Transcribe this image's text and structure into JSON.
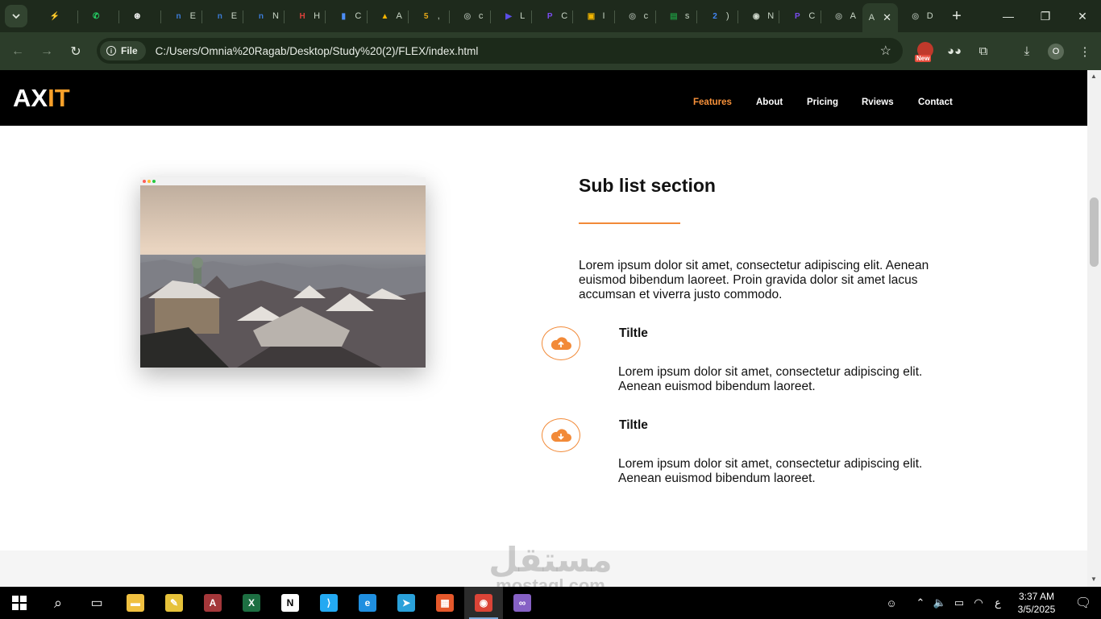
{
  "browser": {
    "tabs": [
      {
        "icon": "sparkle-icon",
        "color": "#f5a623",
        "glyph": "⚡",
        "label": ""
      },
      {
        "icon": "whatsapp-icon",
        "color": "#25d366",
        "glyph": "✆",
        "label": ""
      },
      {
        "icon": "chatgpt-icon",
        "color": "#ffffff",
        "glyph": "⊛",
        "label": ""
      },
      {
        "icon": "notion-n-icon",
        "color": "#3b7bd6",
        "glyph": "n",
        "label": "E"
      },
      {
        "icon": "notion-n-icon",
        "color": "#3b7bd6",
        "glyph": "n",
        "label": "E"
      },
      {
        "icon": "notion-n-icon",
        "color": "#3b7bd6",
        "glyph": "n",
        "label": "N"
      },
      {
        "icon": "hsu-icon",
        "color": "#d9413a",
        "glyph": "H",
        "label": "H"
      },
      {
        "icon": "chart-icon",
        "color": "#4c8df6",
        "glyph": "▮",
        "label": "C"
      },
      {
        "icon": "google-drive-icon",
        "color": "#f4b400",
        "glyph": "▲",
        "label": "A"
      },
      {
        "icon": "five-icon",
        "color": "#e6a817",
        "glyph": "5",
        "label": ","
      },
      {
        "icon": "globe-icon",
        "color": "#9aa59a",
        "glyph": "◎",
        "label": "c"
      },
      {
        "icon": "meet-icon",
        "color": "#5b4ee8",
        "glyph": "▶",
        "label": "L"
      },
      {
        "icon": "p-logo-icon",
        "color": "#7a4cf0",
        "glyph": "P",
        "label": "C"
      },
      {
        "icon": "image-icon",
        "color": "#f0b400",
        "glyph": "▣",
        "label": "I"
      },
      {
        "icon": "globe-icon",
        "color": "#9aa59a",
        "glyph": "◎",
        "label": "c"
      },
      {
        "icon": "classroom-icon",
        "color": "#1e8e3e",
        "glyph": "▤",
        "label": "s"
      },
      {
        "icon": "badge-icon",
        "color": "#4285f4",
        "glyph": "2",
        "label": ")"
      },
      {
        "icon": "github-icon",
        "color": "#cfd8cc",
        "glyph": "◉",
        "label": "N"
      },
      {
        "icon": "p-logo-icon",
        "color": "#7a4cf0",
        "glyph": "P",
        "label": "C"
      },
      {
        "icon": "globe-icon",
        "color": "#9aa59a",
        "glyph": "◎",
        "label": "A"
      }
    ],
    "active_tab_label": "A",
    "after_tab": {
      "icon": "globe-icon",
      "label": "D"
    },
    "chip_label": "File",
    "url": "C:/Users/Omnia%20Ragab/Desktop/Study%20(2)/FLEX/index.html",
    "badge_text": "New",
    "profile_letter": "O"
  },
  "site": {
    "logo_main": "AX",
    "logo_accent": "IT",
    "nav": [
      "Features",
      "About",
      "Pricing",
      "Rviews",
      "Contact"
    ],
    "active_nav": "Features",
    "section_title": "Sub list section",
    "section_text": "Lorem ipsum dolor sit amet, consectetur adipiscing elit. Aenean euismod bibendum laoreet. Proin gravida dolor sit amet lacus accumsan et viverra justo commodo.",
    "features": [
      {
        "icon": "cloud-upload-icon",
        "title": "Tiltle",
        "text": "Lorem ipsum dolor sit amet, consectetur adipiscing elit. Aenean euismod bibendum laoreet."
      },
      {
        "icon": "cloud-download-icon",
        "title": "Tiltle",
        "text": "Lorem ipsum dolor sit amet, consectetur adipiscing elit. Aenean euismod bibendum laoreet."
      }
    ],
    "accent_color": "#f28a38"
  },
  "watermark": {
    "arabic": "مستقل",
    "latin": "mostaql.com"
  },
  "taskbar": {
    "apps": [
      {
        "icon": "file-explorer-icon",
        "color": "#f0c040",
        "glyph": "▬"
      },
      {
        "icon": "sticky-app-icon",
        "color": "#e6c23a",
        "glyph": "✎"
      },
      {
        "icon": "access-icon",
        "color": "#a4373a",
        "glyph": "A"
      },
      {
        "icon": "excel-icon",
        "color": "#1d6f42",
        "glyph": "X"
      },
      {
        "icon": "notion-icon",
        "color": "#ffffff",
        "glyph": "N"
      },
      {
        "icon": "vscode-icon",
        "color": "#23a9f2",
        "glyph": "⟩"
      },
      {
        "icon": "edge-icon",
        "color": "#1f8fe0",
        "glyph": "e"
      },
      {
        "icon": "telegram-icon",
        "color": "#2aa1da",
        "glyph": "➤"
      },
      {
        "icon": "colorful-app-icon",
        "color": "#e5582b",
        "glyph": "▦"
      },
      {
        "icon": "chrome-icon",
        "color": "#db4437",
        "glyph": "◉"
      },
      {
        "icon": "visual-studio-icon",
        "color": "#8661c5",
        "glyph": "∞"
      }
    ],
    "time": "3:37 AM",
    "date": "3/5/2025",
    "lang": "ع"
  }
}
